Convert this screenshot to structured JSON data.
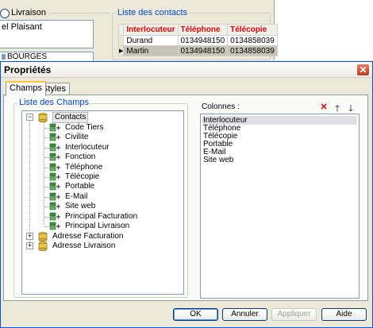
{
  "background": {
    "radio_label": "Livraison",
    "memo_text": "el Plaisant",
    "city_value": "BOURGES",
    "contacts_legend": "Liste des contacts",
    "grid": {
      "headers": [
        "Interlocuteur",
        "Téléphone",
        "Télécopie"
      ],
      "rows": [
        {
          "indicator": "",
          "cells": [
            "Durand",
            "0134948150",
            "0134858039"
          ]
        },
        {
          "indicator": "▶",
          "cells": [
            "Martin",
            "0134948150",
            "0134858039"
          ]
        }
      ]
    }
  },
  "dialog": {
    "title": "Propriétés",
    "close_glyph": "✕",
    "tabs": [
      {
        "label": "Champs",
        "active": true
      },
      {
        "label": "Styles",
        "active": false
      }
    ],
    "fields_legend": "Liste des Champs",
    "tree": {
      "root": {
        "label": "Contacts",
        "expander": "−"
      },
      "children": [
        {
          "label": "Code Tiers"
        },
        {
          "label": "Civilite"
        },
        {
          "label": "Interlocuteur"
        },
        {
          "label": "Fonction"
        },
        {
          "label": "Téléphone"
        },
        {
          "label": "Télécopie"
        },
        {
          "label": "Portable"
        },
        {
          "label": "E-Mail"
        },
        {
          "label": "Site web"
        },
        {
          "label": "Principal Facturation"
        },
        {
          "label": "Principal Livraison"
        }
      ],
      "groups": [
        {
          "label": "Adresse Facturation",
          "expander": "+"
        },
        {
          "label": "Adresse Livraison",
          "expander": "+"
        }
      ]
    },
    "columns": {
      "label": "Colonnes :",
      "items": [
        "Interlocuteur",
        "Téléphone",
        "Télécopie",
        "Portable",
        "E-Mail",
        "Site web"
      ],
      "selected_index": 0,
      "delete_glyph": "✕",
      "up_glyph": "🡑",
      "down_glyph": "🡓"
    },
    "buttons": {
      "ok": "OK",
      "cancel": "Annuler",
      "apply": "Appliquer",
      "help": "Aide"
    }
  },
  "colors": {
    "accent_blue": "#0046d5",
    "header_red": "#e00000",
    "delete_red": "#d00000"
  }
}
